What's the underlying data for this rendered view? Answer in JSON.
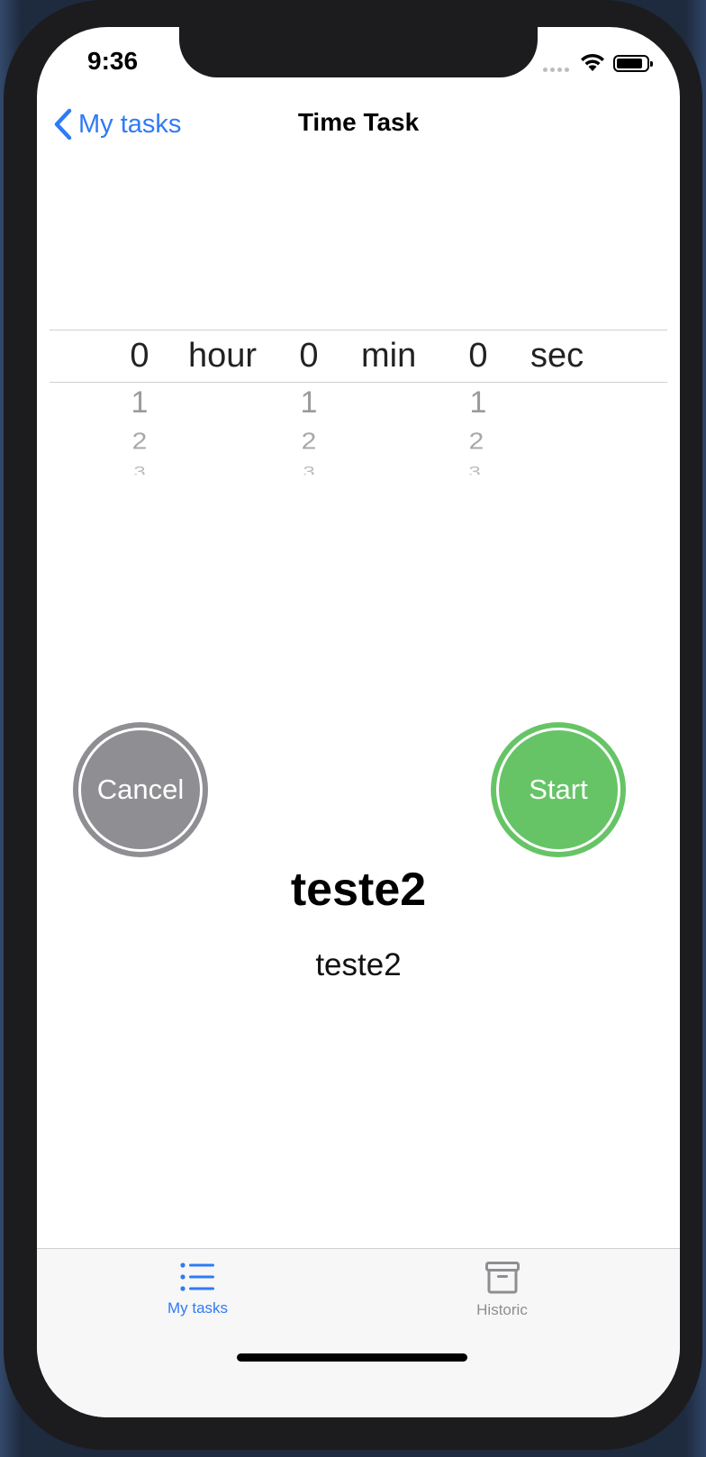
{
  "status_bar": {
    "time": "9:36"
  },
  "nav": {
    "back_label": "My tasks",
    "title": "Time Task"
  },
  "picker": {
    "hours": {
      "selected": "0",
      "unit": "hour",
      "following": [
        "1",
        "2",
        "3"
      ]
    },
    "minutes": {
      "selected": "0",
      "unit": "min",
      "following": [
        "1",
        "2",
        "3"
      ]
    },
    "seconds": {
      "selected": "0",
      "unit": "sec",
      "following": [
        "1",
        "2",
        "3"
      ]
    }
  },
  "buttons": {
    "cancel": "Cancel",
    "start": "Start"
  },
  "task": {
    "title": "teste2",
    "description": "teste2"
  },
  "tabbar": {
    "items": [
      {
        "label": "My tasks",
        "icon": "list-icon",
        "selected": true
      },
      {
        "label": "Historic",
        "icon": "archive-box-icon",
        "selected": false
      }
    ]
  },
  "colors": {
    "accent": "#2f7bf5",
    "cancel": "#8e8e93",
    "start": "#66c466"
  }
}
